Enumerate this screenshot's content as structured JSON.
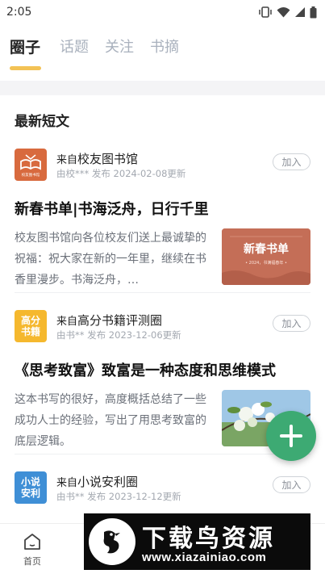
{
  "status_bar": {
    "time": "2:05"
  },
  "tabs": [
    {
      "label": "圈子",
      "active": true
    },
    {
      "label": "话题",
      "active": false
    },
    {
      "label": "关注",
      "active": false
    },
    {
      "label": "书摘",
      "active": false
    }
  ],
  "section_title": "最新短文",
  "posts": [
    {
      "from_prefix": "来自",
      "circle": "校友图书馆",
      "logo_text": "校友图书馆",
      "meta": "由校*** 发布   2024-02-08更新",
      "join_label": "加入",
      "title": "新春书单|书海泛舟，日行千里",
      "summary": "校友图书馆向各位校友们送上最诚挚的祝福：祝大家在新的一年里，继续在书香里漫步。书海泛舟，…",
      "thumb_title": "新春书单",
      "thumb_sub": "• 2024，书满福春年 •"
    },
    {
      "from_prefix": "来自",
      "circle": "高分书籍评测圈",
      "logo_text": "高分\n书籍",
      "meta": "由书** 发布   2023-12-06更新",
      "join_label": "加入",
      "title": "《思考致富》致富是一种态度和思维模式",
      "summary": "这本书写的很好，高度概括总结了一些成功人士的经验，写出了用思考致富的底层逻辑。"
    },
    {
      "from_prefix": "来自",
      "circle": "小说安利圈",
      "logo_text": "小说\n安利",
      "meta": "由书** 发布   2023-12-12更新",
      "join_label": "加入"
    }
  ],
  "bottom_nav": {
    "home_label": "首页"
  },
  "watermark": {
    "title": "下载鸟资源",
    "url": "www.xiazainiao.com"
  },
  "colors": {
    "accent": "#f3c255",
    "fab": "#3daa73",
    "muted": "#a9b1bd"
  }
}
